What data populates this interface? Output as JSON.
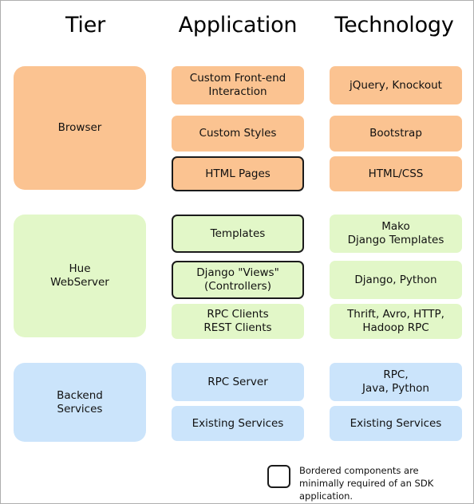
{
  "columns": [
    {
      "label": "Tier"
    },
    {
      "label": "Application"
    },
    {
      "label": "Technology"
    }
  ],
  "colors": {
    "browser": "#fbc391",
    "webserver": "#e2f7c8",
    "backend": "#cbe4fb",
    "border": "#1b1b1b",
    "page_border": "#aeaeae",
    "text": "#111111",
    "background": "#ffffff"
  },
  "tiers": [
    {
      "tier_label": "Browser",
      "tier_bordered": false,
      "palette": "pal-orange",
      "application": [
        {
          "label": "Custom Front-end\nInteraction",
          "bordered": false
        },
        {
          "label": "Custom Styles",
          "bordered": false
        },
        {
          "label": "HTML Pages",
          "bordered": true
        }
      ],
      "technology": [
        {
          "label": "jQuery, Knockout",
          "bordered": false
        },
        {
          "label": "Bootstrap",
          "bordered": false
        },
        {
          "label": "HTML/CSS",
          "bordered": false
        }
      ]
    },
    {
      "tier_label": "Hue\nWebServer",
      "tier_bordered": false,
      "palette": "pal-green",
      "application": [
        {
          "label": "Templates",
          "bordered": true
        },
        {
          "label": "Django \"Views\"\n(Controllers)",
          "bordered": true
        },
        {
          "label": "RPC Clients\nREST Clients",
          "bordered": false
        }
      ],
      "technology": [
        {
          "label": "Mako\nDjango Templates",
          "bordered": false
        },
        {
          "label": "Django, Python",
          "bordered": false
        },
        {
          "label": "Thrift, Avro, HTTP,\nHadoop RPC",
          "bordered": false
        }
      ]
    },
    {
      "tier_label": "Backend\nServices",
      "tier_bordered": false,
      "palette": "pal-blue",
      "application": [
        {
          "label": "RPC Server",
          "bordered": false
        },
        {
          "label": "Existing Services",
          "bordered": false
        }
      ],
      "technology": [
        {
          "label": "RPC,\nJava, Python",
          "bordered": false
        },
        {
          "label": "Existing Services",
          "bordered": false
        }
      ]
    }
  ],
  "legend": {
    "swatch_name": "bordered-component-swatch",
    "text": "Bordered components are minimally required of an SDK application."
  }
}
